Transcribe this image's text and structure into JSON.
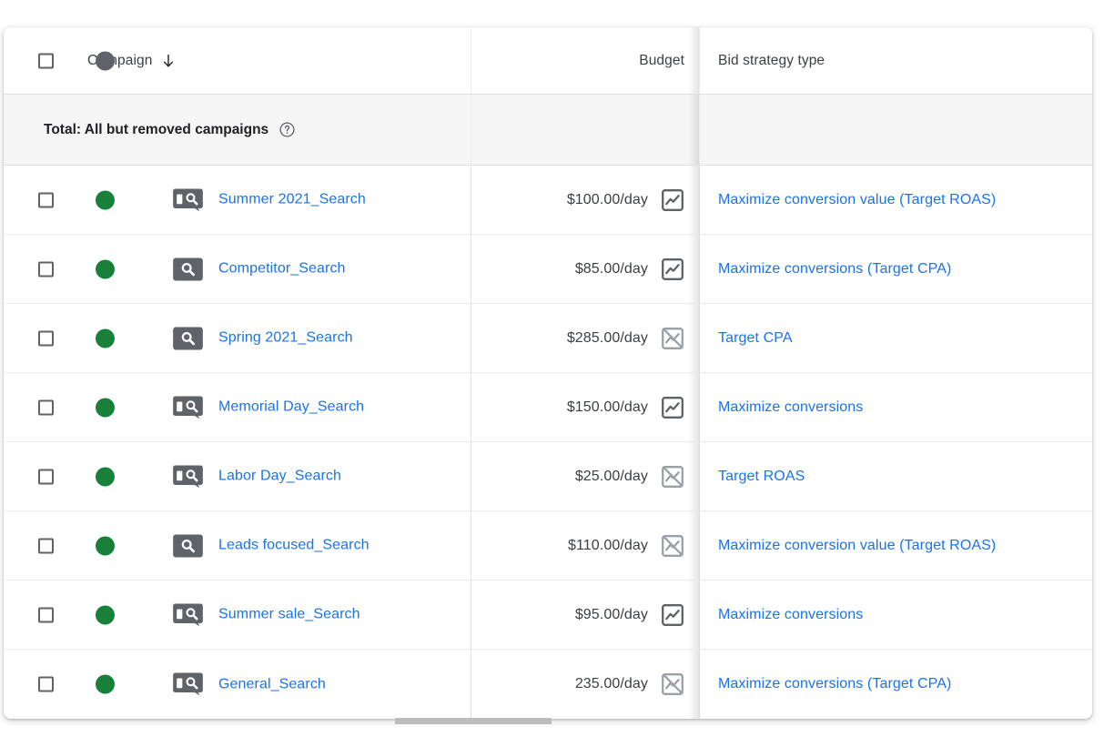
{
  "table": {
    "columns": [
      {
        "key": "campaign",
        "label": "Campaign",
        "sort_icon": "arrow-down-icon"
      },
      {
        "key": "budget",
        "label": "Budget"
      },
      {
        "key": "bid_strategy_type",
        "label": "Bid strategy type"
      }
    ],
    "header": {
      "select_all_checkbox": "unchecked",
      "status_icon": "status-circle-icon"
    },
    "total_row": {
      "label": "Total: All but removed campaigns",
      "help_icon": "help-circle-icon",
      "budget": "",
      "bid_strategy_type": ""
    },
    "rows": [
      {
        "checkbox": "unchecked",
        "status": "enabled",
        "type_icon": "search-partner-icon",
        "campaign": "Summer 2021_Search",
        "budget": "$100.00/day",
        "budget_chart_icon": "chart-icon",
        "budget_chart_enabled": true,
        "bid_strategy_type": "Maximize conversion value (Target ROAS)"
      },
      {
        "checkbox": "unchecked",
        "status": "enabled",
        "type_icon": "search-icon",
        "campaign": "Competitor_Search",
        "budget": "$85.00/day",
        "budget_chart_icon": "chart-icon",
        "budget_chart_enabled": true,
        "bid_strategy_type": "Maximize conversions (Target CPA)"
      },
      {
        "checkbox": "unchecked",
        "status": "enabled",
        "type_icon": "search-icon",
        "campaign": "Spring 2021_Search",
        "budget": "$285.00/day",
        "budget_chart_icon": "chart-off-icon",
        "budget_chart_enabled": false,
        "bid_strategy_type": "Target CPA"
      },
      {
        "checkbox": "unchecked",
        "status": "enabled",
        "type_icon": "search-partner-icon",
        "campaign": "Memorial Day_Search",
        "budget": "$150.00/day",
        "budget_chart_icon": "chart-icon",
        "budget_chart_enabled": true,
        "bid_strategy_type": "Maximize conversions"
      },
      {
        "checkbox": "unchecked",
        "status": "enabled",
        "type_icon": "search-partner-icon",
        "campaign": "Labor Day_Search",
        "budget": "$25.00/day",
        "budget_chart_icon": "chart-off-icon",
        "budget_chart_enabled": false,
        "bid_strategy_type": "Target ROAS"
      },
      {
        "checkbox": "unchecked",
        "status": "enabled",
        "type_icon": "search-icon",
        "campaign": "Leads focused_Search",
        "budget": "$110.00/day",
        "budget_chart_icon": "chart-off-icon",
        "budget_chart_enabled": false,
        "bid_strategy_type": "Maximize conversion value (Target ROAS)"
      },
      {
        "checkbox": "unchecked",
        "status": "enabled",
        "type_icon": "search-partner-icon",
        "campaign": "Summer sale_Search",
        "budget": "$95.00/day",
        "budget_chart_icon": "chart-icon",
        "budget_chart_enabled": true,
        "bid_strategy_type": "Maximize conversions"
      },
      {
        "checkbox": "unchecked",
        "status": "enabled",
        "type_icon": "search-partner-icon",
        "campaign": "General_Search",
        "budget": "235.00/day",
        "budget_chart_icon": "chart-off-icon",
        "budget_chart_enabled": false,
        "bid_strategy_type": "Maximize conversions (Target CPA)"
      }
    ]
  },
  "scrollbar": {
    "orientation": "horizontal",
    "thumb_position_pct": 42
  },
  "colors": {
    "link": "#1a73e8",
    "status_enabled": "#188038",
    "status_header": "#5f6368",
    "icon_dark": "#5f6368",
    "icon_muted": "#9aa0a6",
    "total_row_bg": "#f5f5f5",
    "text": "#3c4043"
  }
}
